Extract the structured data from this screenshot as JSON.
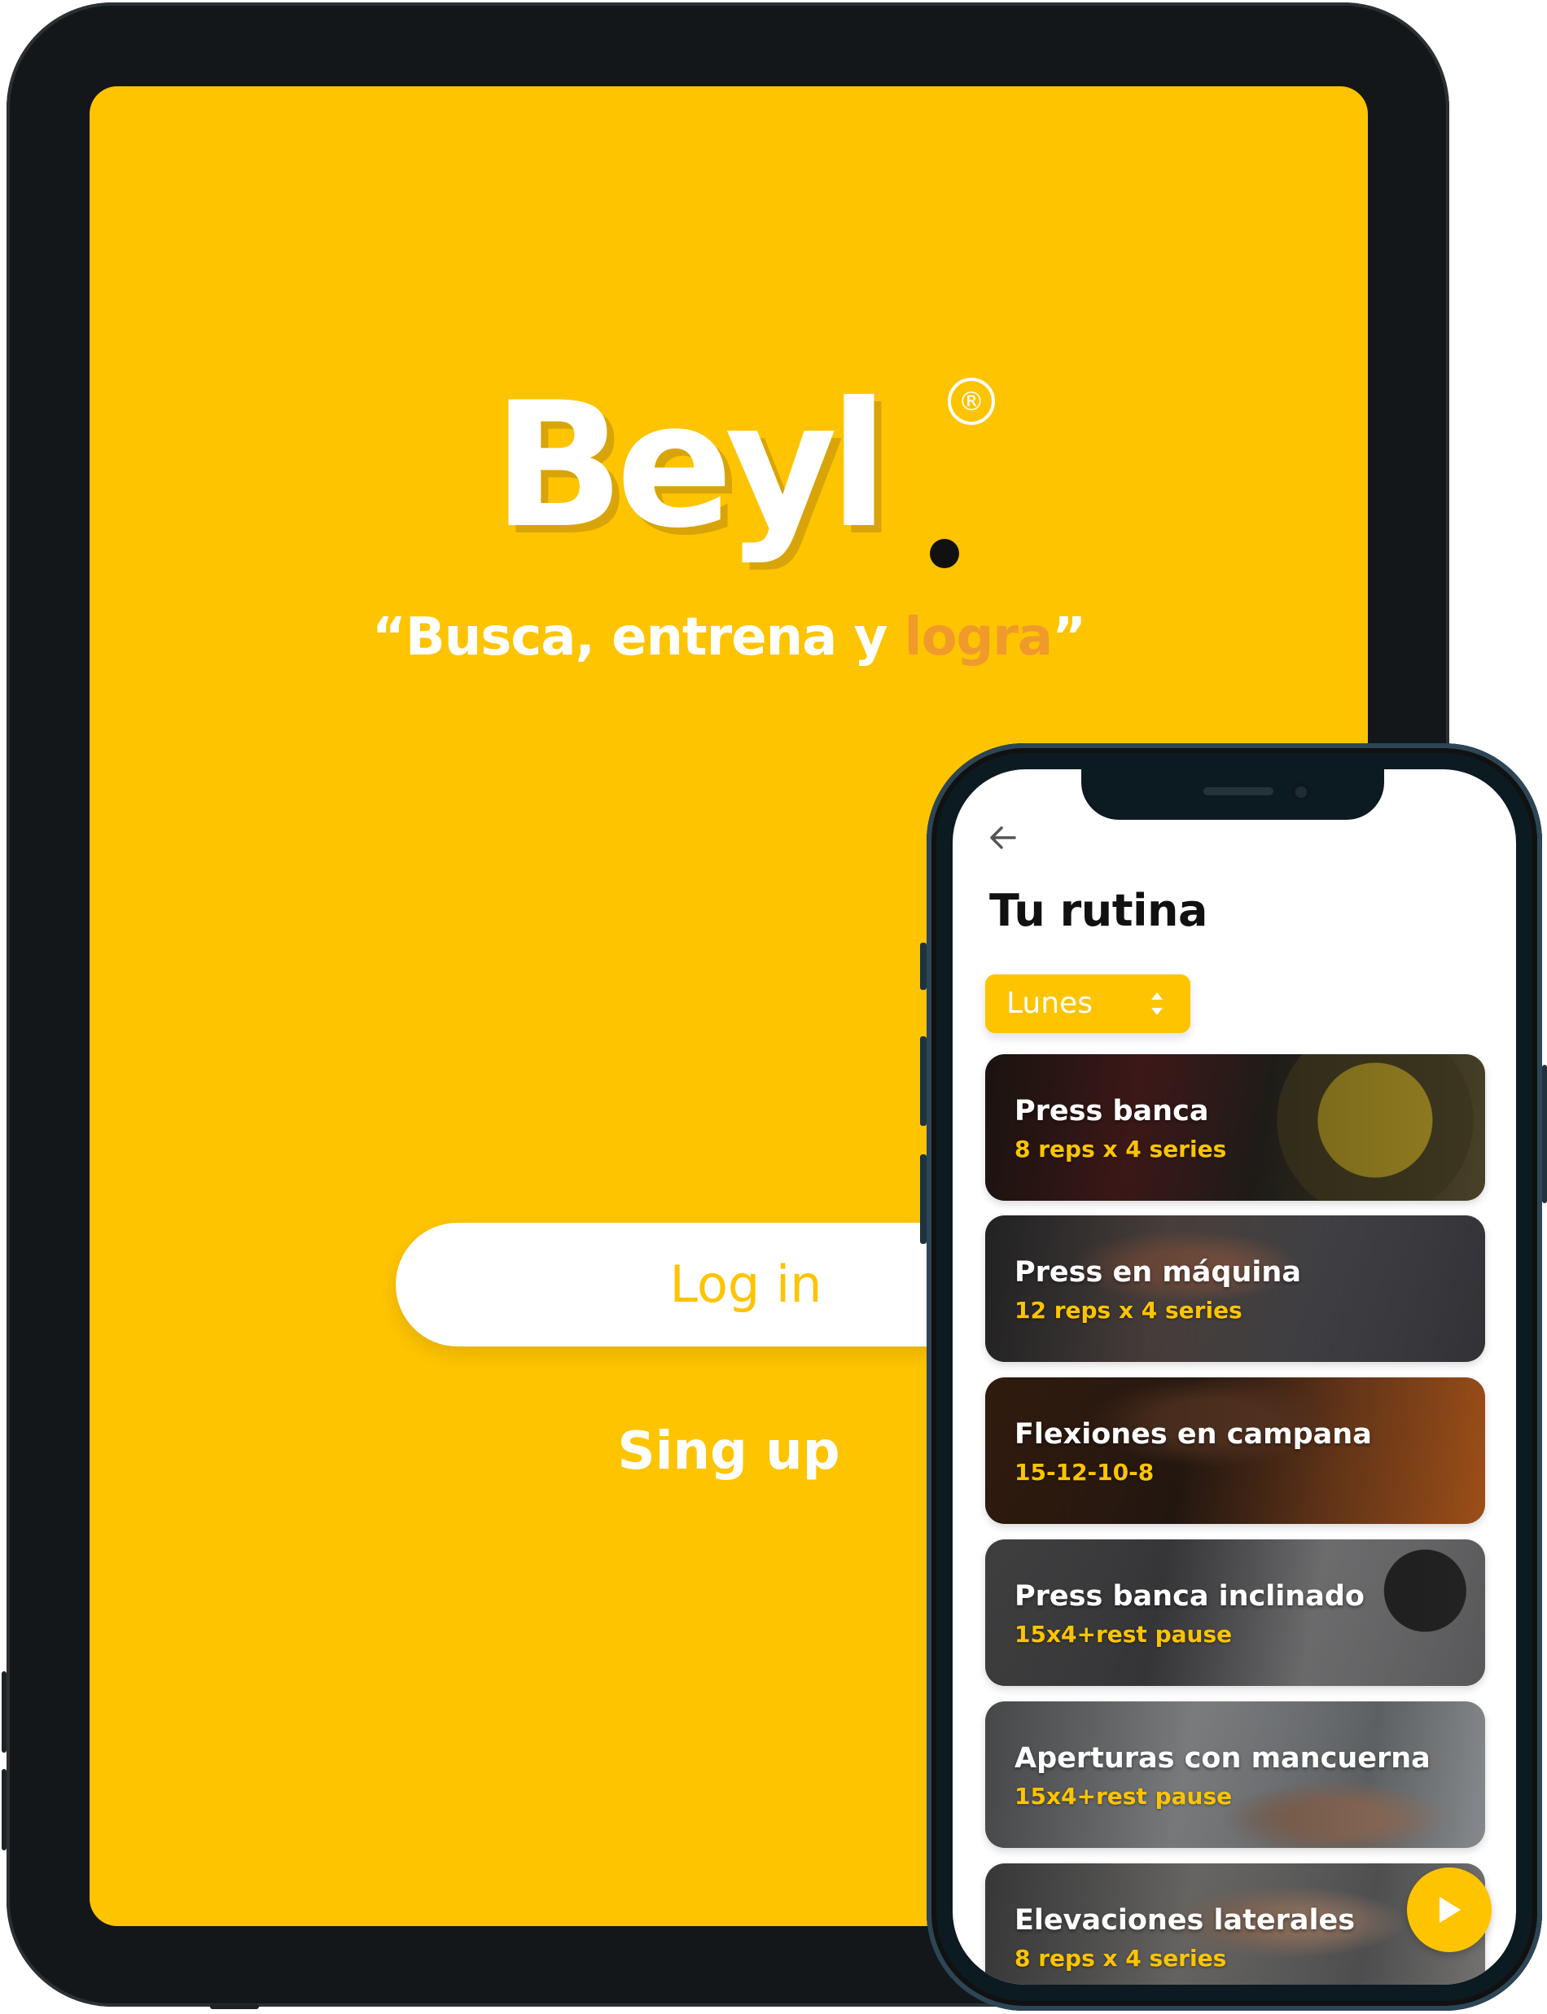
{
  "colors": {
    "brand_yellow": "#fec400",
    "accent_orange": "#f09a2c",
    "device_frame": "#131719",
    "text_dark": "#111111"
  },
  "tablet": {
    "logo": {
      "word": "Beyl",
      "registered_mark": "®"
    },
    "tagline": {
      "open_quote": "“",
      "prefix": "Busca, entrena y ",
      "accent": "logra",
      "close_quote": "”"
    },
    "login_label": "Log in",
    "signup_label": "Sing up"
  },
  "phone": {
    "back_icon": "arrow-left-icon",
    "title": "Tu rutina",
    "day_selector": {
      "value": "Lunes",
      "icon": "updown-chevron-icon"
    },
    "exercises": [
      {
        "name": "Press banca",
        "detail": "8 reps x 4 series"
      },
      {
        "name": "Press en máquina",
        "detail": "12 reps x 4 series"
      },
      {
        "name": "Flexiones en campana",
        "detail": "15-12-10-8"
      },
      {
        "name": "Press banca inclinado",
        "detail": "15x4+rest pause"
      },
      {
        "name": "Aperturas con mancuerna",
        "detail": "15x4+rest pause"
      },
      {
        "name": "Elevaciones laterales",
        "detail": "8 reps x 4 series"
      }
    ],
    "play_icon": "play-icon"
  }
}
